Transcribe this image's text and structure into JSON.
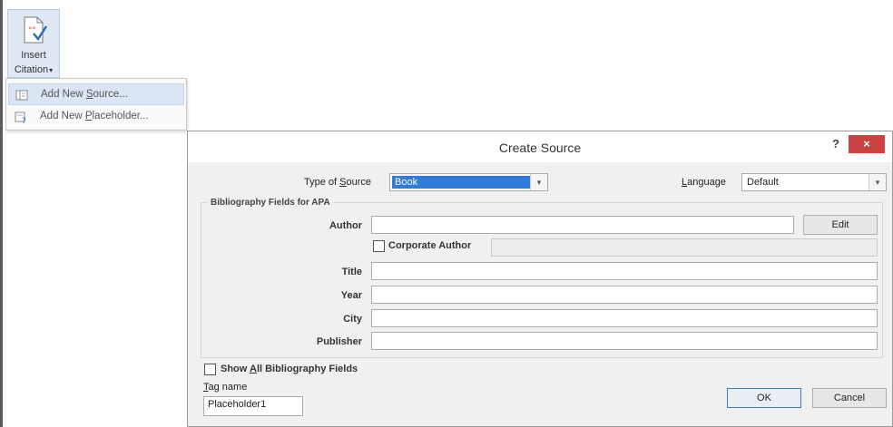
{
  "ribbon": {
    "button_line1": "Insert",
    "button_line2": "Citation",
    "caret": "▾"
  },
  "menu": {
    "items": [
      {
        "pre": "Add New ",
        "accel": "S",
        "post": "ource...",
        "icon": "source-icon"
      },
      {
        "pre": "Add New ",
        "accel": "P",
        "post": "laceholder...",
        "icon": "placeholder-icon"
      }
    ]
  },
  "dialog": {
    "title": "Create Source",
    "help": "?",
    "close": "×",
    "type_of_source_pre": "Type of ",
    "type_of_source_accel": "S",
    "type_of_source_post": "ource",
    "type_of_source_value": "Book",
    "language_accel": "L",
    "language_post": "anguage",
    "language_value": "Default",
    "group_title": "Bibliography Fields for APA",
    "fields": {
      "author_label": "Author",
      "author_value": "",
      "edit_button": "Edit",
      "corporate_author_label": "Corporate Author",
      "corporate_author_checked": false,
      "title_label": "Title",
      "title_value": "",
      "year_label": "Year",
      "year_value": "",
      "city_label": "City",
      "city_value": "",
      "publisher_label": "Publisher",
      "publisher_value": ""
    },
    "show_all_pre": "Show ",
    "show_all_accel": "A",
    "show_all_post": "ll Bibliography Fields",
    "show_all_checked": false,
    "tag_name_accel": "T",
    "tag_name_post": "ag name",
    "tag_name_value": "Placeholder1",
    "ok_button": "OK",
    "cancel_button": "Cancel"
  },
  "colors": {
    "close_button": "#c9423f",
    "selection": "#2f7bd8",
    "menu_hover": "#dae6f3"
  }
}
